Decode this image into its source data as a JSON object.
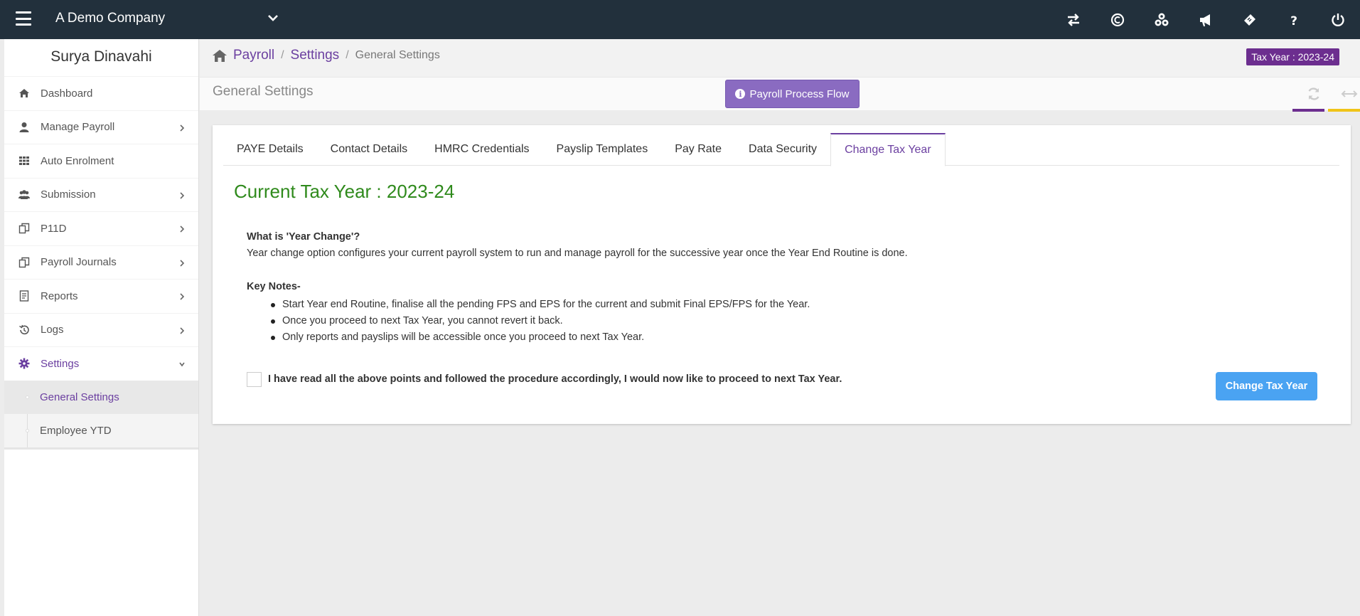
{
  "topbar": {
    "company": "A Demo Company",
    "icons": [
      "menu-icon",
      "chevron-down-icon",
      "switch-icon",
      "credit-icon",
      "modules-icon",
      "announcement-icon",
      "ticket-icon",
      "help-icon",
      "power-icon"
    ]
  },
  "sidebar": {
    "user_name": "Surya Dinavahi",
    "items": [
      {
        "label": "Dashboard",
        "icon": "home-icon",
        "has_chevron": false
      },
      {
        "label": "Manage Payroll",
        "icon": "user-icon",
        "has_chevron": true
      },
      {
        "label": "Auto Enrolment",
        "icon": "grid-icon",
        "has_chevron": false
      },
      {
        "label": "Submission",
        "icon": "users-icon",
        "has_chevron": true
      },
      {
        "label": "P11D",
        "icon": "copy-icon",
        "has_chevron": true
      },
      {
        "label": "Payroll Journals",
        "icon": "copy-icon",
        "has_chevron": true
      },
      {
        "label": "Reports",
        "icon": "report-icon",
        "has_chevron": true
      },
      {
        "label": "Logs",
        "icon": "history-icon",
        "has_chevron": true
      },
      {
        "label": "Settings",
        "icon": "gear-icon",
        "has_chevron": true,
        "expanded": true
      }
    ],
    "sub_items": [
      {
        "label": "General Settings",
        "active": true
      },
      {
        "label": "Employee YTD",
        "active": false
      }
    ]
  },
  "breadcrumb": {
    "items": [
      "Payroll",
      "Settings"
    ],
    "current": "General Settings"
  },
  "tax_badge": "Tax Year : 2023-24",
  "page": {
    "title": "General Settings",
    "flow_button": "Payroll Process Flow"
  },
  "tabs": [
    "PAYE Details",
    "Contact Details",
    "HMRC Credentials",
    "Payslip Templates",
    "Pay Rate",
    "Data Security",
    "Change Tax Year"
  ],
  "active_tab": "Change Tax Year",
  "content": {
    "heading": "Current Tax Year : 2023-24",
    "question": "What is 'Year Change'?",
    "description": "Year change option configures your current payroll system to run and manage payroll for the successive year once the Year End Routine is done.",
    "key_notes_title": "Key Notes-",
    "notes": [
      "Start Year end Routine, finalise all the pending FPS and EPS for the current and submit Final EPS/FPS for the Year.",
      "Once you proceed to next Tax Year, you cannot revert it back.",
      "Only reports and payslips will be accessible once you proceed to next Tax Year."
    ],
    "checkbox_label": "I have read all the above points and followed the procedure accordingly, I would now like to proceed to next Tax Year.",
    "checkbox_checked": false,
    "button": "Change Tax Year"
  },
  "colors": {
    "topbar": "#22303c",
    "accent": "#6b3fa0",
    "heading_green": "#2f8a1c",
    "button_blue": "#4aa3f2",
    "badge_purple": "#6c2e8f",
    "flow_button": "#8a6bc1"
  }
}
